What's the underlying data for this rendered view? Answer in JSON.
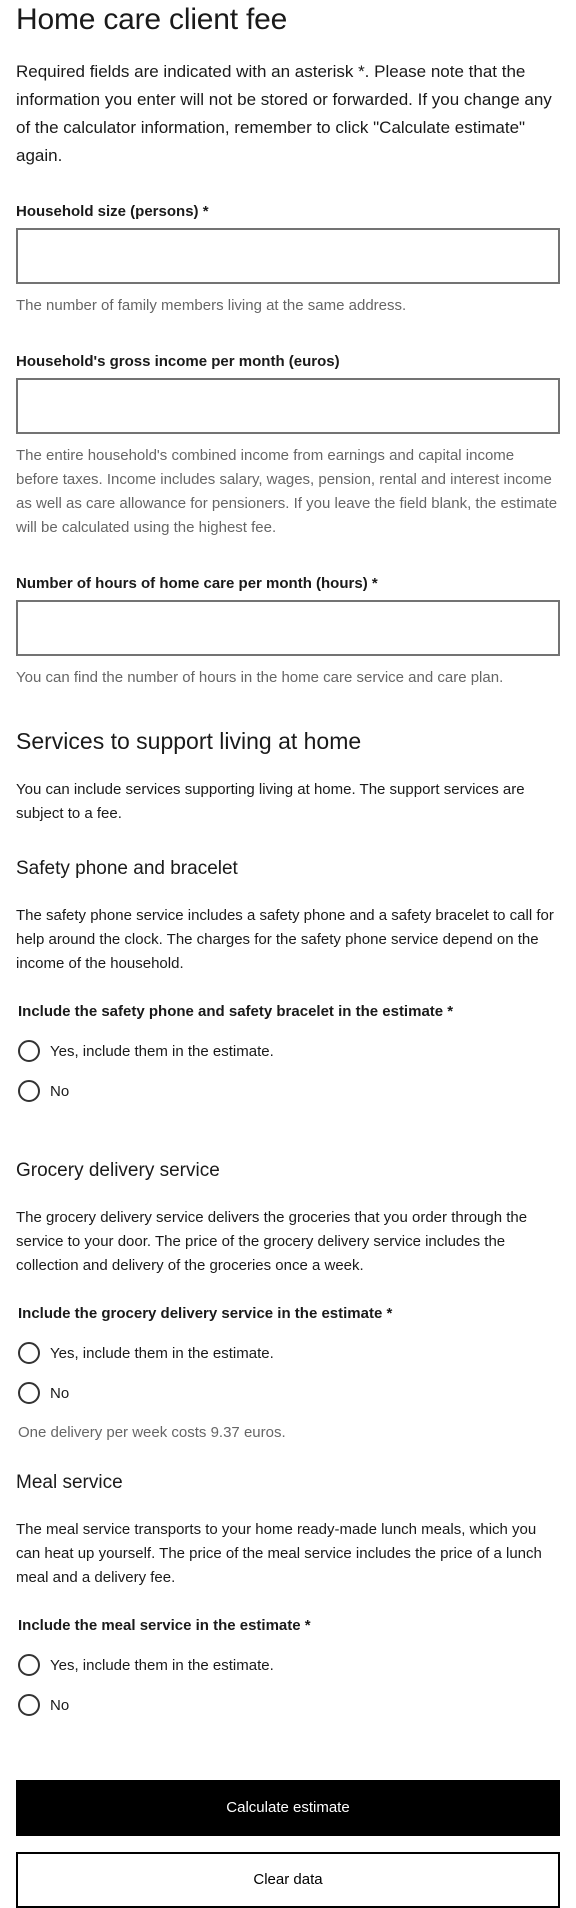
{
  "page": {
    "title": "Home care client fee",
    "intro": "Required fields are indicated with an asterisk *. Please note that the information you enter will not be stored or forwarded. If you change any of the calculator information, remember to click \"Calculate estimate\" again."
  },
  "fields": [
    {
      "label": "Household size (persons) *",
      "value": "",
      "help": "The number of family members living at the same address."
    },
    {
      "label": "Household's gross income per month (euros)",
      "value": "",
      "help": "The entire household's combined income from earnings and capital income before taxes. Income includes salary, wages, pension, rental and interest income as well as care allowance for pensioners. If you leave the field blank, the estimate will be calculated using the highest fee."
    },
    {
      "label": "Number of hours of home care per month (hours) *",
      "value": "",
      "help": "You can find the number of hours in the home care service and care plan."
    }
  ],
  "support": {
    "heading": "Services to support living at home",
    "description": "You can include services supporting living at home. The support services are subject to a fee."
  },
  "services": [
    {
      "heading": "Safety phone and bracelet",
      "description": "The safety phone service includes a safety phone and a safety bracelet to call for help around the clock. The charges for the safety phone service depend on the income of the household.",
      "question": "Include the safety phone and safety bracelet in the estimate *",
      "option_yes": "Yes, include them in the estimate.",
      "option_no": "No",
      "note": ""
    },
    {
      "heading": "Grocery delivery service",
      "description": "The grocery delivery service delivers the groceries that you order through the service to your door. The price of the grocery delivery service includes the collection and delivery of the groceries once a week.",
      "question": "Include the grocery delivery service in the estimate *",
      "option_yes": "Yes, include them in the estimate.",
      "option_no": "No",
      "note": "One delivery per week costs 9.37 euros."
    },
    {
      "heading": "Meal service",
      "description": "The meal service transports to your home ready-made lunch meals, which you can heat up yourself. The price of the meal service includes the price of a lunch meal and a delivery fee.",
      "question": "Include the meal service in the estimate *",
      "option_yes": "Yes, include them in the estimate.",
      "option_no": "No",
      "note": ""
    }
  ],
  "actions": {
    "calculate_label": "Calculate estimate",
    "clear_label": "Clear data"
  }
}
